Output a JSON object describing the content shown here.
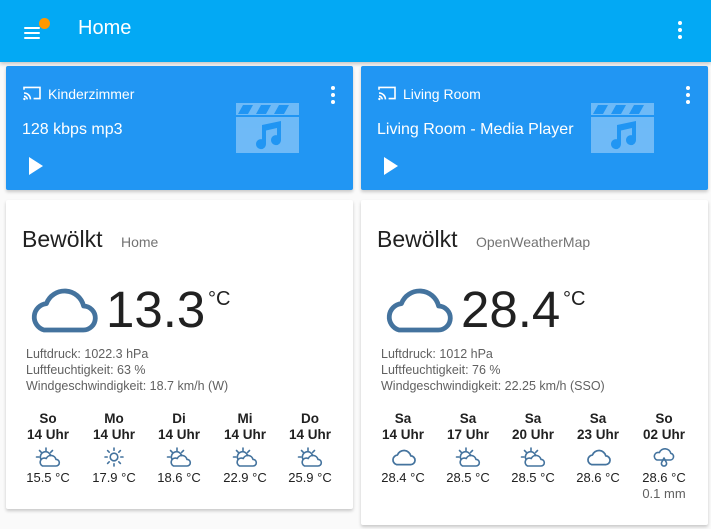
{
  "appbar": {
    "title": "Home",
    "menu_icon": "menu-icon",
    "badge_color": "#ff9800",
    "accent": "#03a9f4"
  },
  "media_players": [
    {
      "name": "Kinderzimmer",
      "title": "128 kbps mp3"
    },
    {
      "name": "Living Room",
      "title": "Living Room - Media Player"
    }
  ],
  "weather_cards": [
    {
      "state": "Bewölkt",
      "name": "Home",
      "temperature": "13.3",
      "unit": "°C",
      "pressure": "Luftdruck: 1022.3 hPa",
      "humidity": "Luftfeuchtigkeit: 63 %",
      "wind": "Windgeschwindigkeit: 18.7 km/h (W)",
      "forecast": [
        {
          "day": "So",
          "time": "14 Uhr",
          "icon": "partly-cloudy-icon",
          "temp": "15.5 °C"
        },
        {
          "day": "Mo",
          "time": "14 Uhr",
          "icon": "sunny-icon",
          "temp": "17.9 °C"
        },
        {
          "day": "Di",
          "time": "14 Uhr",
          "icon": "partly-cloudy-icon",
          "temp": "18.6 °C"
        },
        {
          "day": "Mi",
          "time": "14 Uhr",
          "icon": "partly-cloudy-icon",
          "temp": "22.9 °C"
        },
        {
          "day": "Do",
          "time": "14 Uhr",
          "icon": "partly-cloudy-icon",
          "temp": "25.9 °C"
        }
      ]
    },
    {
      "state": "Bewölkt",
      "name": "OpenWeatherMap",
      "temperature": "28.4",
      "unit": "°C",
      "pressure": "Luftdruck: 1012 hPa",
      "humidity": "Luftfeuchtigkeit: 76 %",
      "wind": "Windgeschwindigkeit: 22.25 km/h (SSO)",
      "forecast": [
        {
          "day": "Sa",
          "time": "14 Uhr",
          "icon": "cloudy-icon",
          "temp": "28.4 °C"
        },
        {
          "day": "Sa",
          "time": "17 Uhr",
          "icon": "partly-cloudy-icon",
          "temp": "28.5 °C"
        },
        {
          "day": "Sa",
          "time": "20 Uhr",
          "icon": "partly-cloudy-icon",
          "temp": "28.5 °C"
        },
        {
          "day": "Sa",
          "time": "23 Uhr",
          "icon": "cloudy-icon",
          "temp": "28.6 °C"
        },
        {
          "day": "So",
          "time": "02 Uhr",
          "icon": "rainy-icon",
          "temp": "28.6 °C",
          "precip": "0.1 mm"
        }
      ]
    }
  ]
}
